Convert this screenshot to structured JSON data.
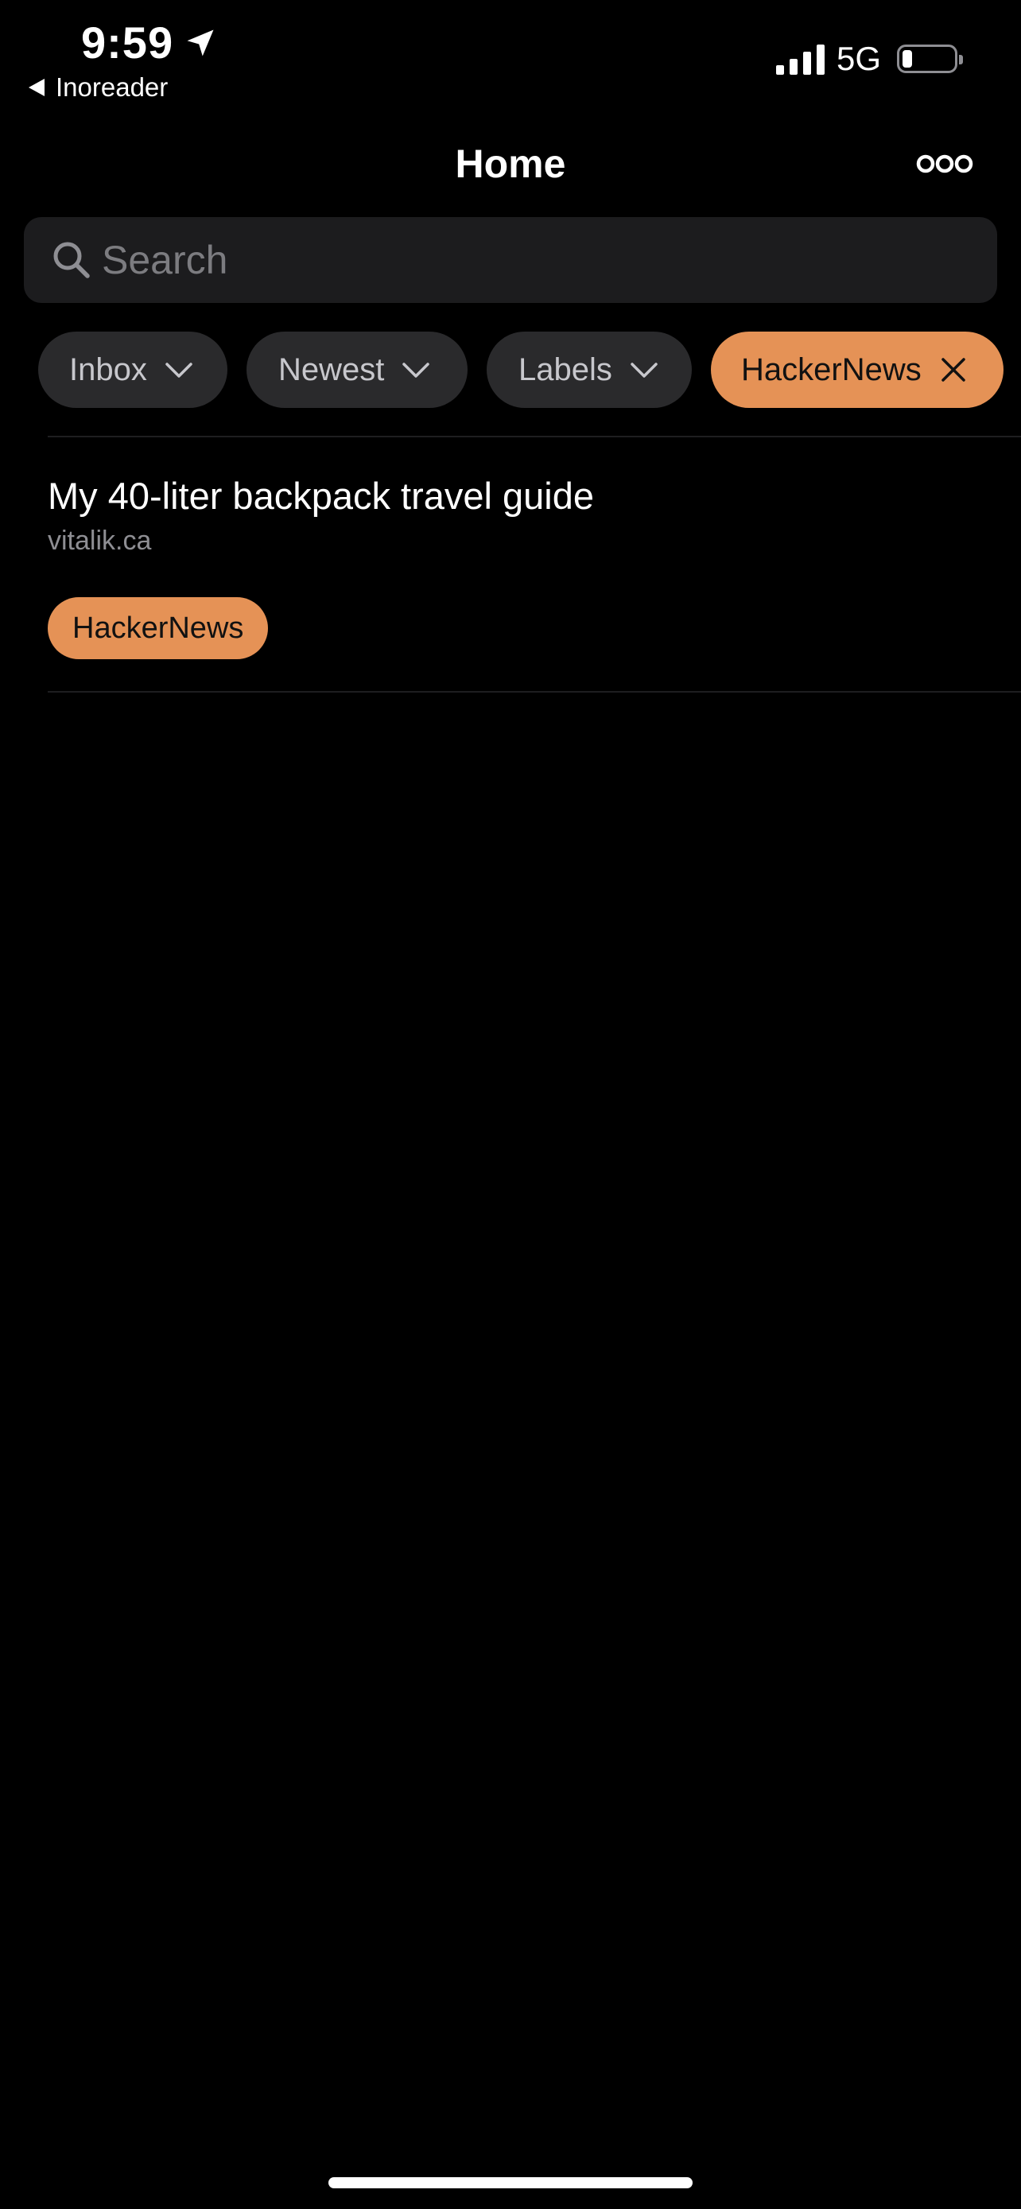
{
  "status_bar": {
    "time": "9:59",
    "back_app": "Inoreader",
    "network": "5G",
    "battery_level": 0.2
  },
  "header": {
    "title": "Home"
  },
  "search": {
    "placeholder": "Search",
    "value": ""
  },
  "filters": {
    "inbox": "Inbox",
    "newest": "Newest",
    "labels": "Labels",
    "active_tag": "HackerNews"
  },
  "articles": [
    {
      "title": "My 40-liter backpack travel guide",
      "source": "vitalik.ca",
      "tag": "HackerNews"
    }
  ],
  "colors": {
    "background": "#000000",
    "accent": "#e59256",
    "chip_bg": "#2a2a2c",
    "search_bg": "#1c1c1e"
  },
  "icons": {
    "location": "location-arrow-icon",
    "back": "back-triangle-icon",
    "signal": "signal-bars-icon",
    "battery": "battery-icon",
    "more": "more-icon",
    "search": "search-icon",
    "chevron": "chevron-down-icon",
    "close": "close-icon"
  }
}
